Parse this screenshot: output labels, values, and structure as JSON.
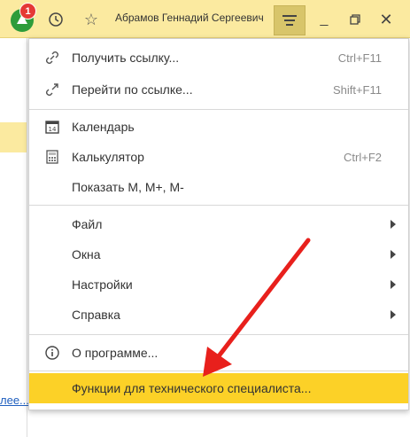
{
  "titlebar": {
    "badge_count": "1",
    "user_name": "Абрамов Геннадий Сергеевич",
    "icons": {
      "app": "app-logo-icon",
      "history": "history-icon",
      "favorite": "star-icon",
      "menu": "hamburger-icon",
      "minimize": "minimize-icon",
      "maximize": "maximize-icon",
      "close": "close-icon"
    }
  },
  "menu": {
    "items": [
      {
        "label": "Получить ссылку...",
        "shortcut": "Ctrl+F11",
        "icon": "link-icon"
      },
      {
        "label": "Перейти по ссылке...",
        "shortcut": "Shift+F11",
        "icon": "goto-link-icon"
      },
      {
        "label": "Календарь",
        "shortcut": "",
        "icon": "calendar-icon"
      },
      {
        "label": "Калькулятор",
        "shortcut": "Ctrl+F2",
        "icon": "calculator-icon"
      },
      {
        "label": "Показать М, М+, М-",
        "shortcut": "",
        "icon": ""
      },
      {
        "label": "Файл",
        "submenu": true
      },
      {
        "label": "Окна",
        "submenu": true
      },
      {
        "label": "Настройки",
        "submenu": true
      },
      {
        "label": "Справка",
        "submenu": true
      },
      {
        "label": "О программе...",
        "shortcut": "",
        "icon": "info-icon"
      },
      {
        "label": "Функции для технического специалиста...",
        "shortcut": "",
        "icon": "",
        "highlighted": true
      }
    ]
  },
  "background": {
    "link_text": "лее..."
  },
  "colors": {
    "titlebar": "#fbeaa0",
    "highlight": "#fcd127",
    "arrow": "#e8201c",
    "badge": "#e53935"
  }
}
